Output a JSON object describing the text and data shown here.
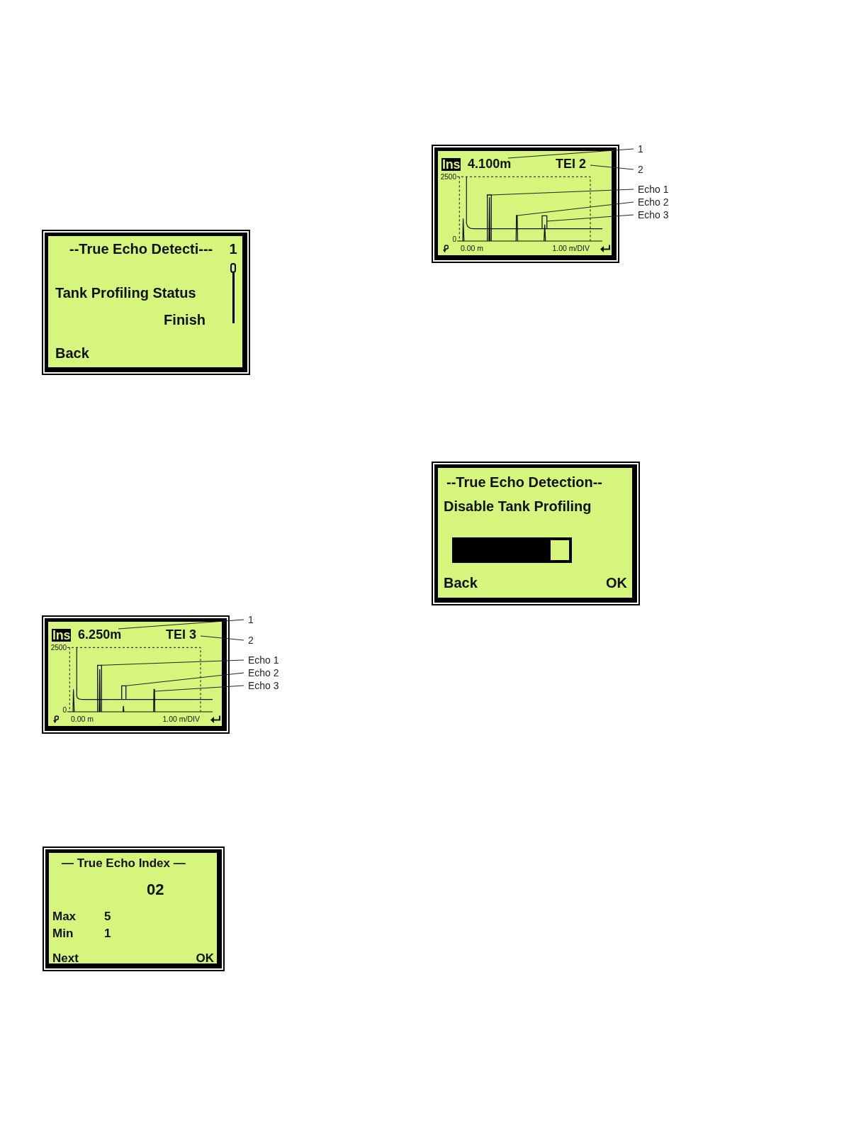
{
  "left_column": [
    {
      "kind": "status_screen",
      "title": "--True Echo Detecti---",
      "page_number": "1",
      "label": "Tank Profiling Status",
      "value": "Finish",
      "softkeys": {
        "left": "Back"
      }
    },
    {
      "kind": "echo_profile",
      "mode_badge": "Ins",
      "distance": "6.250m",
      "tei": "TEI 3",
      "y_max": "2500",
      "y_min": "0",
      "x_start": "0.00 m",
      "x_scale": "1.00 m/DIV",
      "callouts": [
        "1",
        "2",
        "Echo 1",
        "Echo 2",
        "Echo 3"
      ]
    },
    {
      "kind": "index_screen",
      "title": "— True Echo Index —",
      "value": "02",
      "limits": [
        {
          "label": "Max",
          "value": "5"
        },
        {
          "label": "Min",
          "value": "1"
        }
      ],
      "softkeys": {
        "left": "Next",
        "right": "OK"
      }
    }
  ],
  "right_column": [
    {
      "kind": "echo_profile",
      "mode_badge": "Ins",
      "distance": "4.100m",
      "tei": "TEI 2",
      "y_max": "2500",
      "y_min": "0",
      "x_start": "0.00 m",
      "x_scale": "1.00 m/DIV",
      "callouts": [
        "1",
        "2",
        "Echo 1",
        "Echo 2",
        "Echo 3"
      ]
    },
    {
      "kind": "progress_screen",
      "title": "--True Echo Detection--",
      "label": "Disable Tank Profiling",
      "progress": {
        "level": 0.84
      },
      "softkeys": {
        "left": "Back",
        "right": "OK"
      }
    }
  ]
}
